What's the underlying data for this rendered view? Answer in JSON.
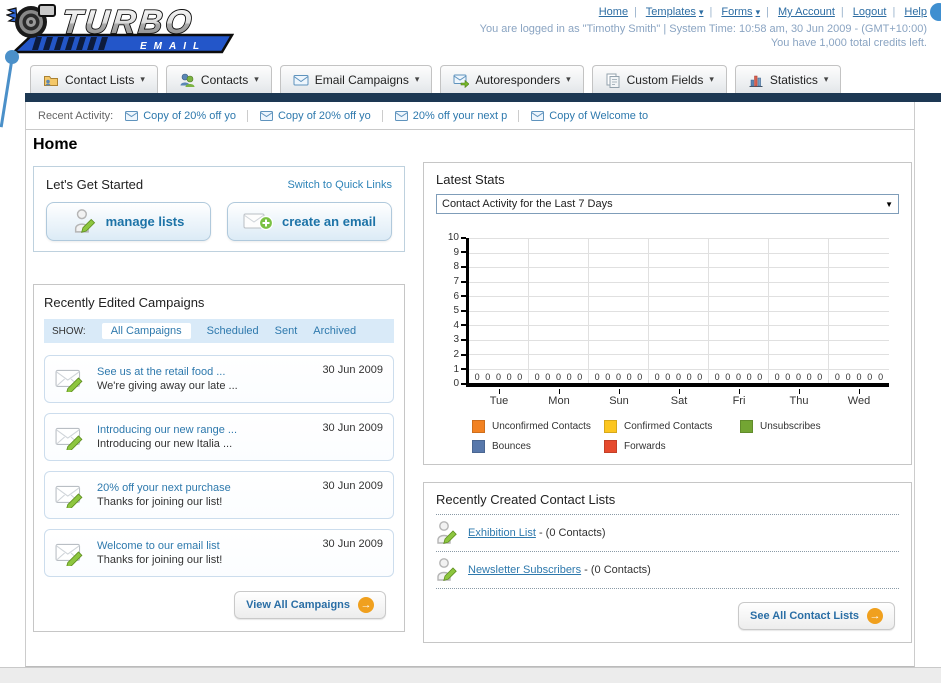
{
  "ui": {
    "pipe": "|",
    "caret_down": "▾",
    "select_arrow": "▼",
    "arrow_right": "→"
  },
  "header": {
    "logo_title": "TURBO",
    "logo_subtitle": "EMAIL",
    "nav_links": [
      {
        "label": "Home",
        "dropdown": false
      },
      {
        "label": "Templates",
        "dropdown": true
      },
      {
        "label": "Forms",
        "dropdown": true
      },
      {
        "label": "My Account",
        "dropdown": false
      },
      {
        "label": "Logout",
        "dropdown": false
      },
      {
        "label": "Help",
        "dropdown": false
      }
    ],
    "login_info": "You are logged in as \"Timothy Smith\" | System Time: 10:58 am, 30 Jun 2009 - (GMT+10:00)",
    "credits_info": "You have 1,000 total credits left."
  },
  "nav_tabs": [
    {
      "label": "Contact Lists"
    },
    {
      "label": "Contacts"
    },
    {
      "label": "Email Campaigns"
    },
    {
      "label": "Autoresponders"
    },
    {
      "label": "Custom Fields"
    },
    {
      "label": "Statistics"
    }
  ],
  "recent_activity": {
    "label": "Recent Activity:",
    "items": [
      "Copy of 20% off yo",
      "Copy of 20% off yo",
      "20% off your next p",
      "Copy of Welcome to"
    ]
  },
  "page_title": "Home",
  "get_started": {
    "title": "Let's Get Started",
    "switch_link": "Switch to Quick Links",
    "buttons": [
      {
        "label": "manage lists"
      },
      {
        "label": "create an email"
      }
    ]
  },
  "campaigns": {
    "title": "Recently Edited Campaigns",
    "show_label": "SHOW:",
    "filters": [
      "All Campaigns",
      "Scheduled",
      "Sent",
      "Archived"
    ],
    "active_filter": "All Campaigns",
    "items": [
      {
        "title": "See us at the retail food ...",
        "subtitle": "We're giving away our late ...",
        "date": "30 Jun 2009"
      },
      {
        "title": "Introducing our new range ...",
        "subtitle": "Introducing our new Italia ...",
        "date": "30 Jun 2009"
      },
      {
        "title": "20% off your next purchase",
        "subtitle": "Thanks for joining our list!",
        "date": "30 Jun 2009"
      },
      {
        "title": "Welcome to our email list",
        "subtitle": "Thanks for joining our list!",
        "date": "30 Jun 2009"
      }
    ],
    "view_all_label": "View All Campaigns"
  },
  "stats": {
    "title": "Latest Stats",
    "dropdown_value": "Contact Activity for the Last 7 Days"
  },
  "chart_data": {
    "type": "bar",
    "title": "Contact Activity for the Last 7 Days",
    "categories": [
      "Tue",
      "Mon",
      "Sun",
      "Sat",
      "Fri",
      "Thu",
      "Wed"
    ],
    "series": [
      {
        "name": "Unconfirmed Contacts",
        "color": "#f28222",
        "values": [
          0,
          0,
          0,
          0,
          0,
          0,
          0
        ]
      },
      {
        "name": "Confirmed Contacts",
        "color": "#fcc620",
        "values": [
          0,
          0,
          0,
          0,
          0,
          0,
          0
        ]
      },
      {
        "name": "Unsubscribes",
        "color": "#73a533",
        "values": [
          0,
          0,
          0,
          0,
          0,
          0,
          0
        ]
      },
      {
        "name": "Bounces",
        "color": "#5878ab",
        "values": [
          0,
          0,
          0,
          0,
          0,
          0,
          0
        ]
      },
      {
        "name": "Forwards",
        "color": "#e64a2e",
        "values": [
          0,
          0,
          0,
          0,
          0,
          0,
          0
        ]
      }
    ],
    "xlabel": "",
    "ylabel": "",
    "ylim": [
      0,
      10
    ],
    "yticks": [
      0,
      1,
      2,
      3,
      4,
      5,
      6,
      7,
      8,
      9,
      10
    ],
    "grid": true,
    "legend_position": "bottom"
  },
  "contact_lists": {
    "title": "Recently Created Contact Lists",
    "items": [
      {
        "name": "Exhibition List",
        "detail": "- (0 Contacts)"
      },
      {
        "name": "Newsletter Subscribers",
        "detail": "- (0 Contacts)"
      }
    ],
    "see_all_label": "See All Contact Lists"
  },
  "colors": {
    "navy_bar": "#1d3853",
    "link_blue": "#2e79ad",
    "button_text_blue": "#1d73a7",
    "orange_arrow": "#f0a01e",
    "decoration_blue": "#4b90c9"
  }
}
